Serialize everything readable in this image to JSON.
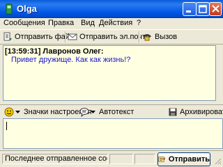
{
  "window": {
    "title": "Olga"
  },
  "menu": {
    "items": [
      {
        "label": "Сообщения"
      },
      {
        "label": "Правка"
      },
      {
        "label": "Вид"
      },
      {
        "label": "Действия"
      },
      {
        "label": "?"
      }
    ]
  },
  "toolbar": {
    "send_file": "Отправить файл",
    "send_email": "Отправить эл.почту",
    "call": "Вызов"
  },
  "chat": {
    "messages": [
      {
        "header": "[13:59:31] Лавронов Олег:",
        "text": "Привет дружище. Как как жизнь!?"
      }
    ]
  },
  "moodbar": {
    "mood_label": "Значки настроения",
    "autotext_label": "Автотекст",
    "archive_label": "Архивировать"
  },
  "input": {
    "value": ""
  },
  "status": {
    "last_sent": "Последнее отправленное сообщ...",
    "send_button": "Отправить"
  },
  "colors": {
    "title_bar": "#0058e6",
    "pane_bg": "#ffffe1",
    "message_text": "#1a1ad0",
    "window_bg": "#ece9d8"
  }
}
